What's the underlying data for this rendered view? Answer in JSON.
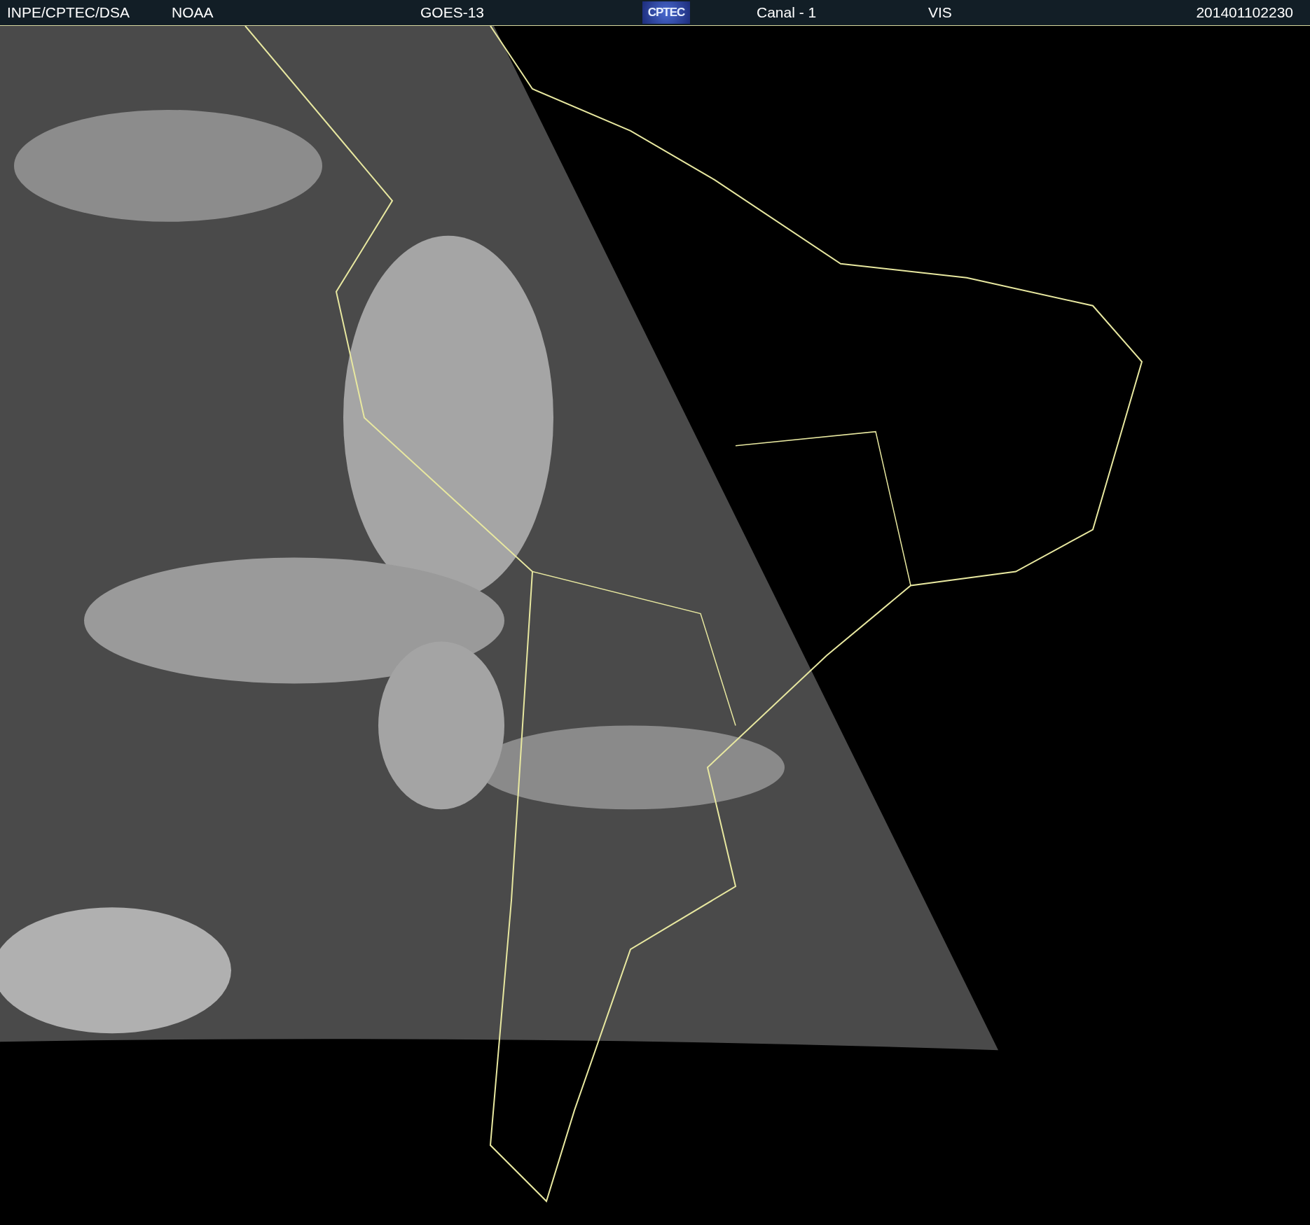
{
  "header": {
    "source": "INPE/CPTEC/DSA",
    "agency": "NOAA",
    "satellite": "GOES-13",
    "logo": "CPTEC",
    "channel": "Canal - 1",
    "band": "VIS",
    "timestamp": "201401102230"
  }
}
